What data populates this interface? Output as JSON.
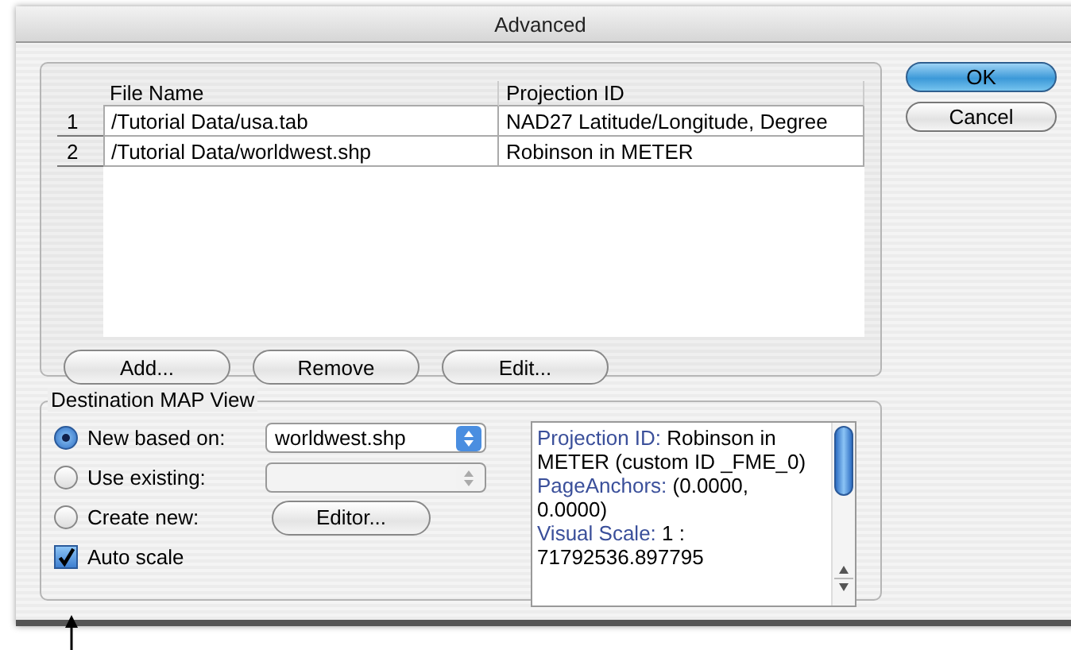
{
  "window": {
    "title": "Advanced"
  },
  "files": {
    "columns": [
      "File Name",
      "Projection ID"
    ],
    "rows": [
      {
        "number": "1",
        "file": "/Tutorial Data/usa.tab",
        "projection": "NAD27 Latitude/Longitude, Degree"
      },
      {
        "number": "2",
        "file": "/Tutorial Data/worldwest.shp",
        "projection": "Robinson in METER"
      }
    ]
  },
  "file_buttons": [
    "Add...",
    "Remove",
    "Edit..."
  ],
  "destination": {
    "title": "Destination MAP View",
    "options": [
      {
        "kind": "popup",
        "label": "New based on:",
        "selected": true,
        "value": "worldwest.shp",
        "disabled": false
      },
      {
        "kind": "popup",
        "label": "Use existing:",
        "selected": false,
        "disabled": true
      },
      {
        "kind": "button",
        "label": "Create new:",
        "selected": false,
        "button": "Editor..."
      }
    ],
    "auto_scale": {
      "label": "Auto scale",
      "checked": true
    },
    "info": [
      {
        "label": "Projection ID:",
        "value": "Robinson in METER (custom ID _FME_0)"
      },
      {
        "label": "PageAnchors:",
        "value": "(0.0000, 0.0000)"
      },
      {
        "label": "Visual Scale:",
        "value": "1 : 71792536.897795"
      }
    ]
  },
  "dialog_buttons": [
    {
      "label": "OK",
      "default": true
    },
    {
      "label": "Cancel",
      "default": false
    }
  ]
}
